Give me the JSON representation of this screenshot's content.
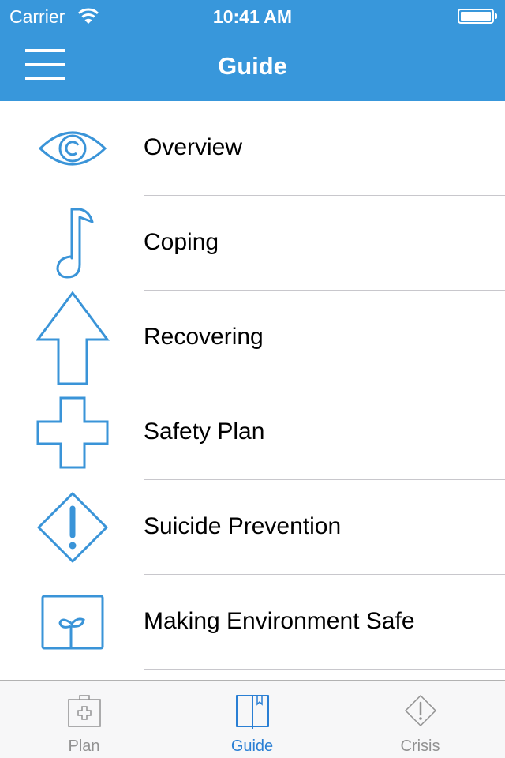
{
  "status_bar": {
    "carrier": "Carrier",
    "time": "10:41 AM",
    "wifi_icon": "wifi-icon",
    "battery_icon": "battery-full-icon"
  },
  "header": {
    "title": "Guide",
    "menu_icon": "hamburger-menu-icon",
    "background_color": "#3897db"
  },
  "guide_items": [
    {
      "label": "Overview",
      "icon": "eye-icon"
    },
    {
      "label": "Coping",
      "icon": "music-note-icon"
    },
    {
      "label": "Recovering",
      "icon": "arrow-up-icon"
    },
    {
      "label": "Safety Plan",
      "icon": "cross-icon"
    },
    {
      "label": "Suicide Prevention",
      "icon": "warning-diamond-icon"
    },
    {
      "label": "Making Environment Safe",
      "icon": "sprout-box-icon"
    },
    {
      "label": "",
      "icon": "circle-icon"
    }
  ],
  "tabbar": {
    "tabs": [
      {
        "label": "Plan",
        "icon": "first-aid-kit-icon",
        "active": false
      },
      {
        "label": "Guide",
        "icon": "book-icon",
        "active": true
      },
      {
        "label": "Crisis",
        "icon": "warning-diamond-icon",
        "active": false
      }
    ],
    "active_color": "#2a7fd4",
    "inactive_color": "#929292"
  },
  "icon_color": "#3a94d8"
}
